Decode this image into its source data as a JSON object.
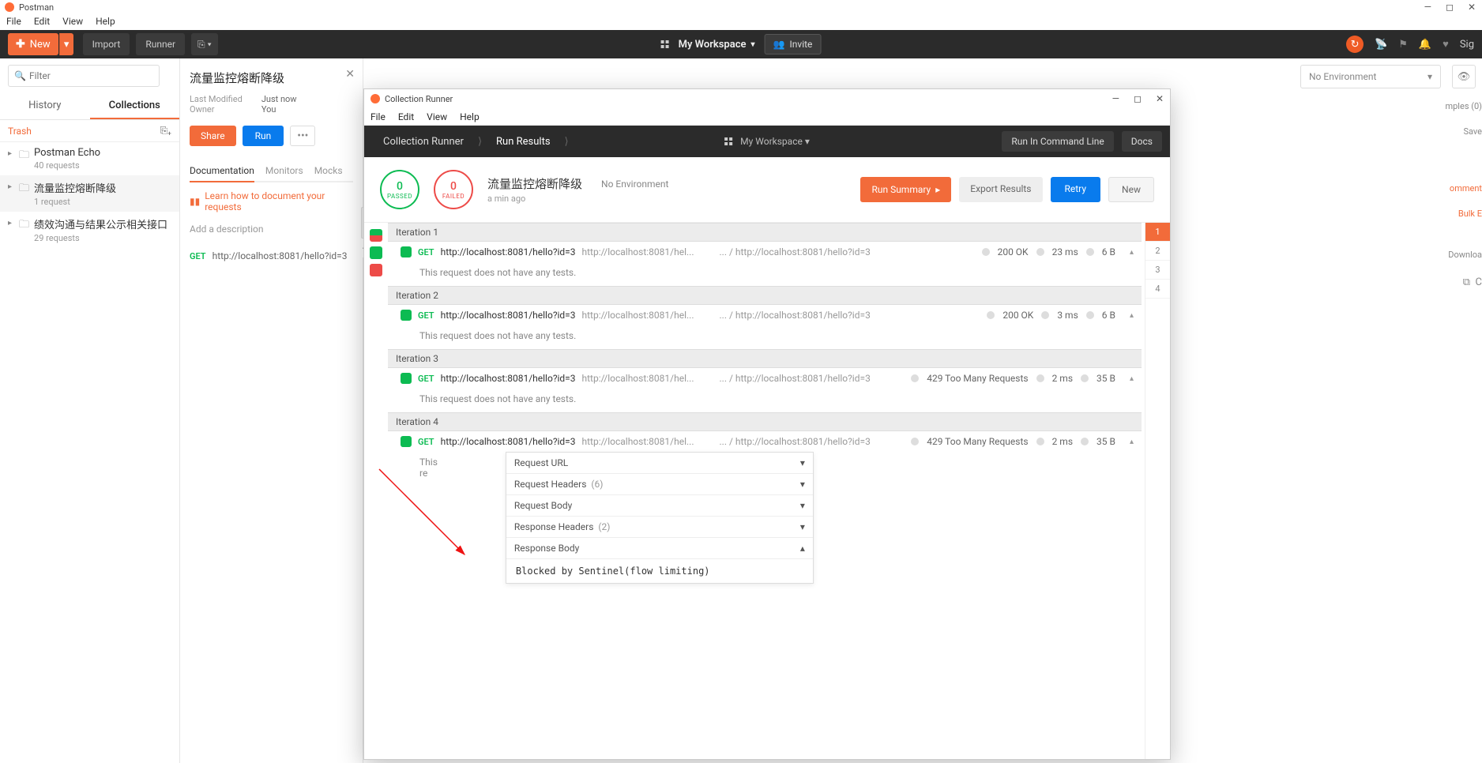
{
  "app": {
    "title": "Postman",
    "menus": [
      "File",
      "Edit",
      "View",
      "Help"
    ]
  },
  "toolbar": {
    "new": "New",
    "import": "Import",
    "runner": "Runner",
    "workspace": "My Workspace",
    "invite": "Invite",
    "signin": "Sig"
  },
  "sidebar": {
    "filter_placeholder": "Filter",
    "tabs": {
      "history": "History",
      "collections": "Collections"
    },
    "trash": "Trash",
    "collections": [
      {
        "name": "Postman Echo",
        "sub": "40 requests"
      },
      {
        "name": "流量监控熔断降级",
        "sub": "1 request"
      },
      {
        "name": "绩效沟通与结果公示相关接口",
        "sub": "29 requests"
      }
    ]
  },
  "doc": {
    "title": "流量监控熔断降级",
    "meta": {
      "lm_label": "Last Modified",
      "lm_val": "Just now",
      "owner_label": "Owner",
      "owner_val": "You"
    },
    "share": "Share",
    "run": "Run",
    "tabs": [
      "Documentation",
      "Monitors",
      "Mocks"
    ],
    "learn": "Learn how to document your requests",
    "add_desc": "Add a description",
    "request": {
      "method": "GET",
      "url": "http://localhost:8081/hello?id=3"
    }
  },
  "env": {
    "no_env": "No Environment",
    "examples": "mples (0)",
    "save": "Save",
    "comments": "omment",
    "bulk": "Bulk E",
    "download": "Downloa"
  },
  "runner": {
    "title": "Collection Runner",
    "menus": [
      "File",
      "Edit",
      "View",
      "Help"
    ],
    "crumbs": {
      "a": "Collection Runner",
      "b": "Run Results"
    },
    "workspace": "My Workspace",
    "cmd": "Run In Command Line",
    "docs": "Docs",
    "passed": {
      "n": "0",
      "l": "PASSED"
    },
    "failed": {
      "n": "0",
      "l": "FAILED"
    },
    "coll_name": "流量监控熔断降级",
    "coll_env": "No Environment",
    "coll_time": "a min ago",
    "buttons": {
      "summary": "Run Summary",
      "export": "Export Results",
      "retry": "Retry",
      "new": "New"
    },
    "no_tests": "This request does not have any tests.",
    "iterations": [
      {
        "label": "Iteration 1",
        "method": "GET",
        "url": "http://localhost:8081/hello?id=3",
        "url2": "http://localhost:8081/hel...",
        "path": "... / http://localhost:8081/hello?id=3",
        "status": "200 OK",
        "time": "23 ms",
        "size": "6 B"
      },
      {
        "label": "Iteration 2",
        "method": "GET",
        "url": "http://localhost:8081/hello?id=3",
        "url2": "http://localhost:8081/hel...",
        "path": "... / http://localhost:8081/hello?id=3",
        "status": "200 OK",
        "time": "3 ms",
        "size": "6 B"
      },
      {
        "label": "Iteration 3",
        "method": "GET",
        "url": "http://localhost:8081/hello?id=3",
        "url2": "http://localhost:8081/hel...",
        "path": "... / http://localhost:8081/hello?id=3",
        "status": "429 Too Many Requests",
        "time": "2 ms",
        "size": "35 B"
      },
      {
        "label": "Iteration 4",
        "method": "GET",
        "url": "http://localhost:8081/hello?id=3",
        "url2": "http://localhost:8081/hel...",
        "path": "... / http://localhost:8081/hello?id=3",
        "status": "429 Too Many Requests",
        "time": "2 ms",
        "size": "35 B"
      }
    ],
    "detail": {
      "rows": [
        {
          "label": "Request URL",
          "count": ""
        },
        {
          "label": "Request Headers",
          "count": "(6)"
        },
        {
          "label": "Request Body",
          "count": ""
        },
        {
          "label": "Response Headers",
          "count": "(2)"
        },
        {
          "label": "Response Body",
          "count": ""
        }
      ],
      "body": "Blocked by Sentinel(flow limiting)"
    },
    "this_req_trunc": "This re",
    "nav_items": [
      "1",
      "2",
      "3",
      "4"
    ]
  }
}
